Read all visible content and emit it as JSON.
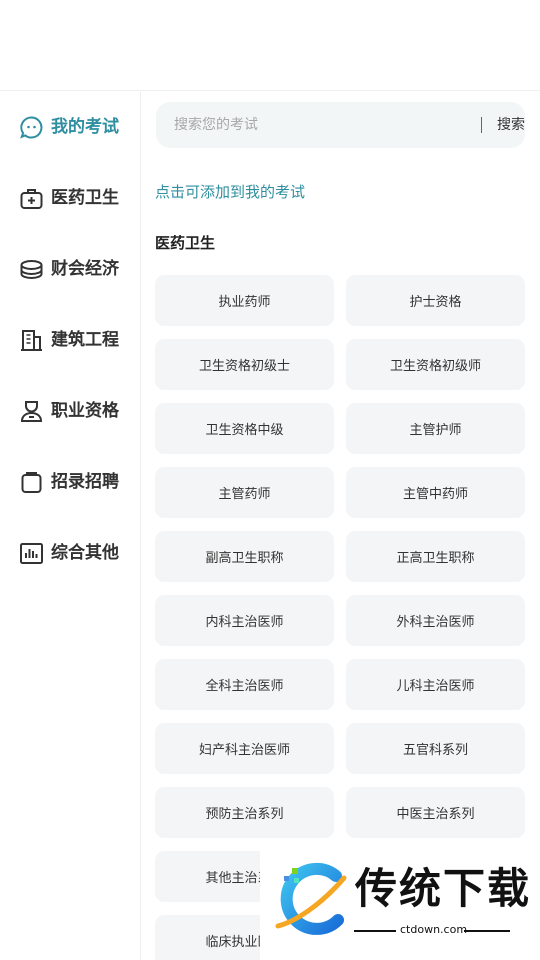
{
  "sidebar": {
    "items": [
      {
        "label": "我的考试",
        "icon": "chat-bubble-icon",
        "active": true
      },
      {
        "label": "医药卫生",
        "icon": "medical-kit-icon",
        "active": false
      },
      {
        "label": "财会经济",
        "icon": "coin-stack-icon",
        "active": false
      },
      {
        "label": "建筑工程",
        "icon": "building-icon",
        "active": false
      },
      {
        "label": "职业资格",
        "icon": "worker-icon",
        "active": false
      },
      {
        "label": "招录招聘",
        "icon": "clipboard-icon",
        "active": false
      },
      {
        "label": "综合其他",
        "icon": "bar-chart-icon",
        "active": false
      }
    ]
  },
  "search": {
    "placeholder": "搜索您的考试",
    "button_label": "搜索"
  },
  "hint": "点击可添加到我的考试",
  "section": {
    "title": "医药卫生",
    "items": [
      "执业药师",
      "护士资格",
      "卫生资格初级士",
      "卫生资格初级师",
      "卫生资格中级",
      "主管护师",
      "主管药师",
      "主管中药师",
      "副高卫生职称",
      "正高卫生职称",
      "内科主治医师",
      "外科主治医师",
      "全科主治医师",
      "儿科主治医师",
      "妇产科主治医师",
      "五官科系列",
      "预防主治系列",
      "中医主治系列",
      "其他主治系列",
      "",
      "临床执业医师",
      ""
    ]
  },
  "watermark": {
    "brand": "传统下载",
    "url": "ctdown.com"
  },
  "colors": {
    "accent": "#2f8fa0",
    "chip_bg": "#f4f5f7",
    "search_bg": "#f2f6f6"
  }
}
